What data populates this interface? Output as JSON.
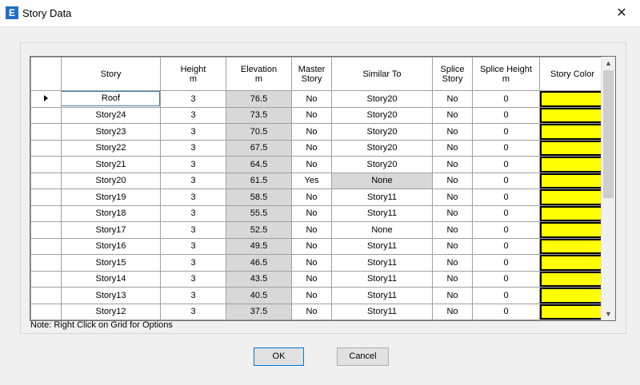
{
  "window": {
    "title": "Story Data",
    "icon_letter": "E",
    "close_glyph": "✕"
  },
  "grid": {
    "columns": [
      {
        "line1": "",
        "line2": ""
      },
      {
        "line1": "Story",
        "line2": ""
      },
      {
        "line1": "Height",
        "line2": "m"
      },
      {
        "line1": "Elevation",
        "line2": "m"
      },
      {
        "line1": "Master",
        "line2": "Story"
      },
      {
        "line1": "Similar To",
        "line2": ""
      },
      {
        "line1": "Splice",
        "line2": "Story"
      },
      {
        "line1": "Splice Height",
        "line2": "m"
      },
      {
        "line1": "Story Color",
        "line2": ""
      }
    ],
    "rows": [
      {
        "story": "Roof",
        "height": "3",
        "elevation": "76.5",
        "master": "No",
        "similar": "Story20",
        "splice": "No",
        "splice_height": "0",
        "current": true
      },
      {
        "story": "Story24",
        "height": "3",
        "elevation": "73.5",
        "master": "No",
        "similar": "Story20",
        "splice": "No",
        "splice_height": "0"
      },
      {
        "story": "Story23",
        "height": "3",
        "elevation": "70.5",
        "master": "No",
        "similar": "Story20",
        "splice": "No",
        "splice_height": "0"
      },
      {
        "story": "Story22",
        "height": "3",
        "elevation": "67.5",
        "master": "No",
        "similar": "Story20",
        "splice": "No",
        "splice_height": "0"
      },
      {
        "story": "Story21",
        "height": "3",
        "elevation": "64.5",
        "master": "No",
        "similar": "Story20",
        "splice": "No",
        "splice_height": "0"
      },
      {
        "story": "Story20",
        "height": "3",
        "elevation": "61.5",
        "master": "Yes",
        "similar": "None",
        "splice": "No",
        "splice_height": "0",
        "similar_readonly": true
      },
      {
        "story": "Story19",
        "height": "3",
        "elevation": "58.5",
        "master": "No",
        "similar": "Story11",
        "splice": "No",
        "splice_height": "0"
      },
      {
        "story": "Story18",
        "height": "3",
        "elevation": "55.5",
        "master": "No",
        "similar": "Story11",
        "splice": "No",
        "splice_height": "0"
      },
      {
        "story": "Story17",
        "height": "3",
        "elevation": "52.5",
        "master": "No",
        "similar": "None",
        "splice": "No",
        "splice_height": "0"
      },
      {
        "story": "Story16",
        "height": "3",
        "elevation": "49.5",
        "master": "No",
        "similar": "Story11",
        "splice": "No",
        "splice_height": "0"
      },
      {
        "story": "Story15",
        "height": "3",
        "elevation": "46.5",
        "master": "No",
        "similar": "Story11",
        "splice": "No",
        "splice_height": "0"
      },
      {
        "story": "Story14",
        "height": "3",
        "elevation": "43.5",
        "master": "No",
        "similar": "Story11",
        "splice": "No",
        "splice_height": "0"
      },
      {
        "story": "Story13",
        "height": "3",
        "elevation": "40.5",
        "master": "No",
        "similar": "Story11",
        "splice": "No",
        "splice_height": "0"
      },
      {
        "story": "Story12",
        "height": "3",
        "elevation": "37.5",
        "master": "No",
        "similar": "Story11",
        "splice": "No",
        "splice_height": "0"
      }
    ],
    "story_color": "#ffff00",
    "readonly_color": "#d8d8d8"
  },
  "scrollbar": {
    "up_glyph": "▲",
    "down_glyph": "▼"
  },
  "note": "Note:  Right Click on Grid for Options",
  "buttons": {
    "ok": "OK",
    "cancel": "Cancel"
  }
}
